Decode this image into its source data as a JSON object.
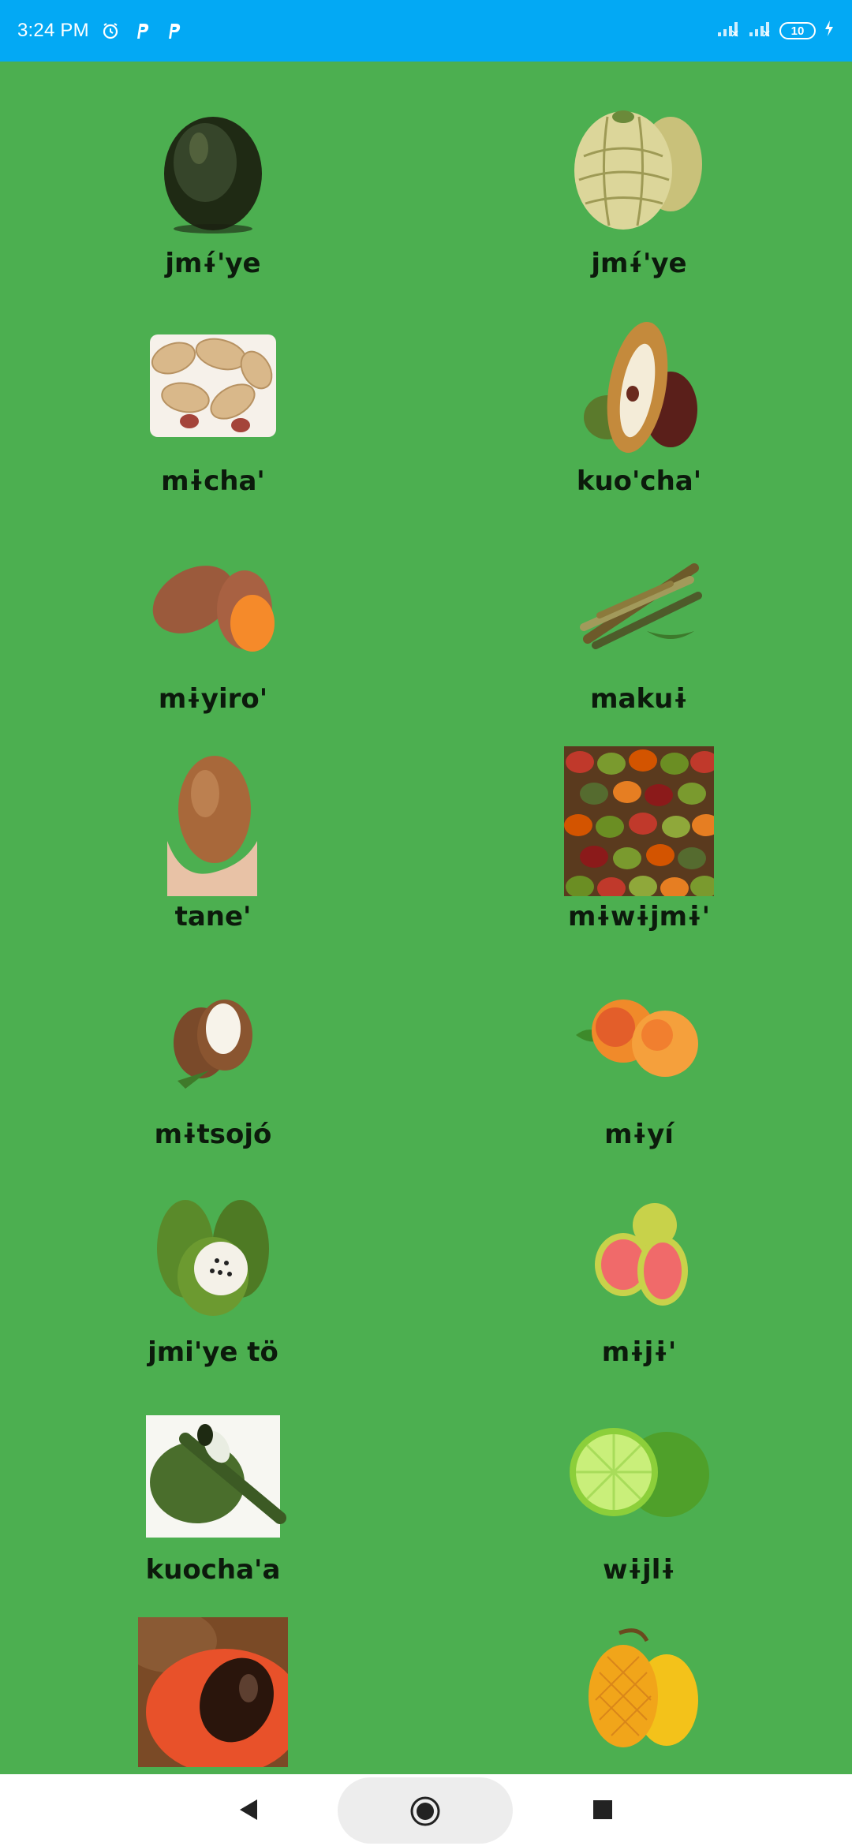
{
  "status_bar": {
    "time": "3:24 PM",
    "battery": "10",
    "icons": [
      "alarm-icon",
      "p-app-icon",
      "p-app-icon",
      "signal-icon",
      "signal-icon",
      "battery-icon",
      "charging-icon"
    ],
    "background": "#03a9f4"
  },
  "colors": {
    "background": "#4caf50",
    "label": "#0c1a0c"
  },
  "items": [
    {
      "label": "jmɨ́'ye",
      "image": "avocado"
    },
    {
      "label": "jmɨ́'ye",
      "image": "sugar-apple"
    },
    {
      "label": "mɨcha'",
      "image": "peanuts"
    },
    {
      "label": "kuo'cha'",
      "image": "cacao-pod"
    },
    {
      "label": "mɨyiro'",
      "image": "sweet-potato"
    },
    {
      "label": "makuɨ",
      "image": "sugarcane"
    },
    {
      "label": "tane'",
      "image": "potato"
    },
    {
      "label": "mɨwɨjmɨ'",
      "image": "mangoes-pile"
    },
    {
      "label": "mɨtsojó",
      "image": "coconut"
    },
    {
      "label": "mɨyí",
      "image": "peaches"
    },
    {
      "label": "jmi'ye tö",
      "image": "soursop"
    },
    {
      "label": "mɨjɨ'",
      "image": "guava"
    },
    {
      "label": "kuocha'a",
      "image": "inga-pod"
    },
    {
      "label": "wɨjlɨ",
      "image": "lime"
    },
    {
      "label": "",
      "image": "mamey"
    },
    {
      "label": "",
      "image": "mango"
    }
  ],
  "nav_bar": {
    "icons": [
      "back-icon",
      "home-icon",
      "recents-icon"
    ]
  }
}
